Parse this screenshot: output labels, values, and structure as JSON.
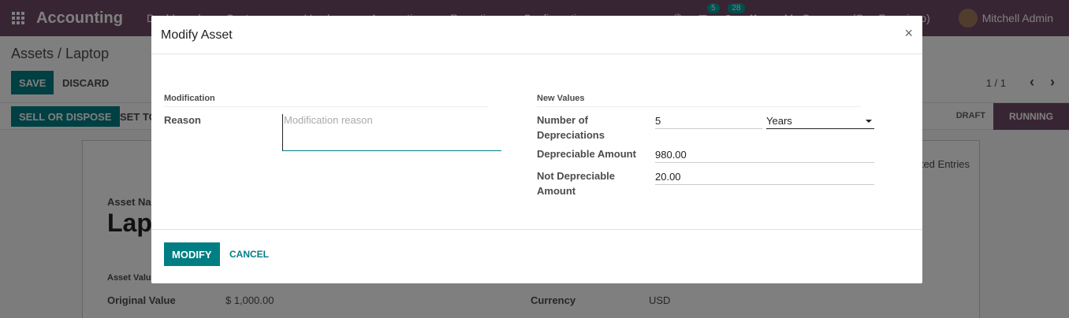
{
  "navbar": {
    "brand": "Accounting",
    "menu": [
      "Dashboard",
      "Customers",
      "Vendors",
      "Accounting",
      "Reporting",
      "Configuration"
    ],
    "chat_badge": "5",
    "activity_badge": "28",
    "company": "My Company (San Francisco)",
    "user": "Mitchell Admin"
  },
  "control_panel": {
    "breadcrumb": "Assets / Laptop",
    "save_label": "SAVE",
    "discard_label": "DISCARD",
    "pager": "1 / 1",
    "sell_label": "SELL OR DISPOSE",
    "set_to_label": "SET TO",
    "stage_draft": "DRAFT",
    "stage_running": "RUNNING"
  },
  "sheet": {
    "tab_partial": "ted Entries",
    "asset_name_label": "Asset Nar",
    "asset_name": "Lapt",
    "asset_values_label": "Asset Valu",
    "original_value_label": "Original Value",
    "original_value": "$ 1,000.00",
    "currency_label": "Currency",
    "currency_value": "USD"
  },
  "modal": {
    "title": "Modify Asset",
    "close_glyph": "×",
    "modification_group": "Modification",
    "reason_label": "Reason",
    "reason_placeholder": "Modification reason",
    "reason_value": "",
    "new_values_group": "New Values",
    "number_of_depreciations_label": "Number of Depreciations",
    "number_of_depreciations_value": "5",
    "period_unit": "Years",
    "depreciable_amount_label": "Depreciable Amount",
    "depreciable_amount_value": "980.00",
    "not_depreciable_amount_label": "Not Depreciable Amount",
    "not_depreciable_amount_value": "20.00",
    "modify_label": "MODIFY",
    "cancel_label": "CANCEL"
  },
  "colors": {
    "brand": "#714b67",
    "primary": "#017e84"
  }
}
